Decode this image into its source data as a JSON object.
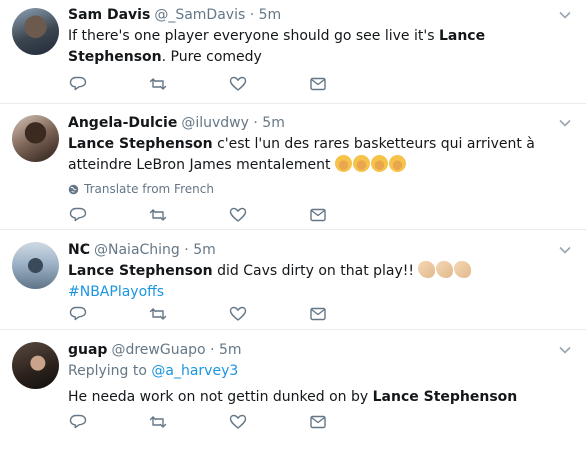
{
  "tweets": [
    {
      "name": "Sam Davis",
      "handle": "@_SamDavis",
      "time": "5m",
      "text_before": "If there's one player everyone should go see live it's ",
      "bold": "Lance Stephenson",
      "text_after": ". Pure comedy"
    },
    {
      "name": "Angela-Dulcie",
      "handle": "@iluvdwy",
      "time": "5m",
      "bold": "Lance Stephenson",
      "text_after": " c'est l'un des rares basketteurs qui arrivent à atteindre LeBron James mentalement",
      "emoji": [
        "loudly-crying-face",
        "loudly-crying-face",
        "loudly-crying-face",
        "loudly-crying-face"
      ],
      "translate": "Translate from French"
    },
    {
      "name": "NC",
      "handle": "@NaiaChing",
      "time": "5m",
      "bold": "Lance Stephenson",
      "text_after": " did Cavs dirty on that play!! ",
      "emoji": [
        "flexed-biceps",
        "flexed-biceps",
        "flexed-biceps"
      ],
      "hashtag": "#NBAPlayoffs"
    },
    {
      "name": "guap",
      "handle": "@drewGuapo",
      "time": "5m",
      "replying_label": "Replying to ",
      "replying_handle": "@a_harvey3",
      "text_before": "He needa work on not gettin dunked on by ",
      "bold": "Lance Stephenson"
    }
  ],
  "separator": "·",
  "icons": [
    "reply-icon",
    "retweet-icon",
    "like-icon",
    "message-icon",
    "chevron-down-icon",
    "globe-icon"
  ],
  "colors": {
    "link": "#1b95e0",
    "muted": "#657786",
    "border": "#e6ecf0"
  }
}
